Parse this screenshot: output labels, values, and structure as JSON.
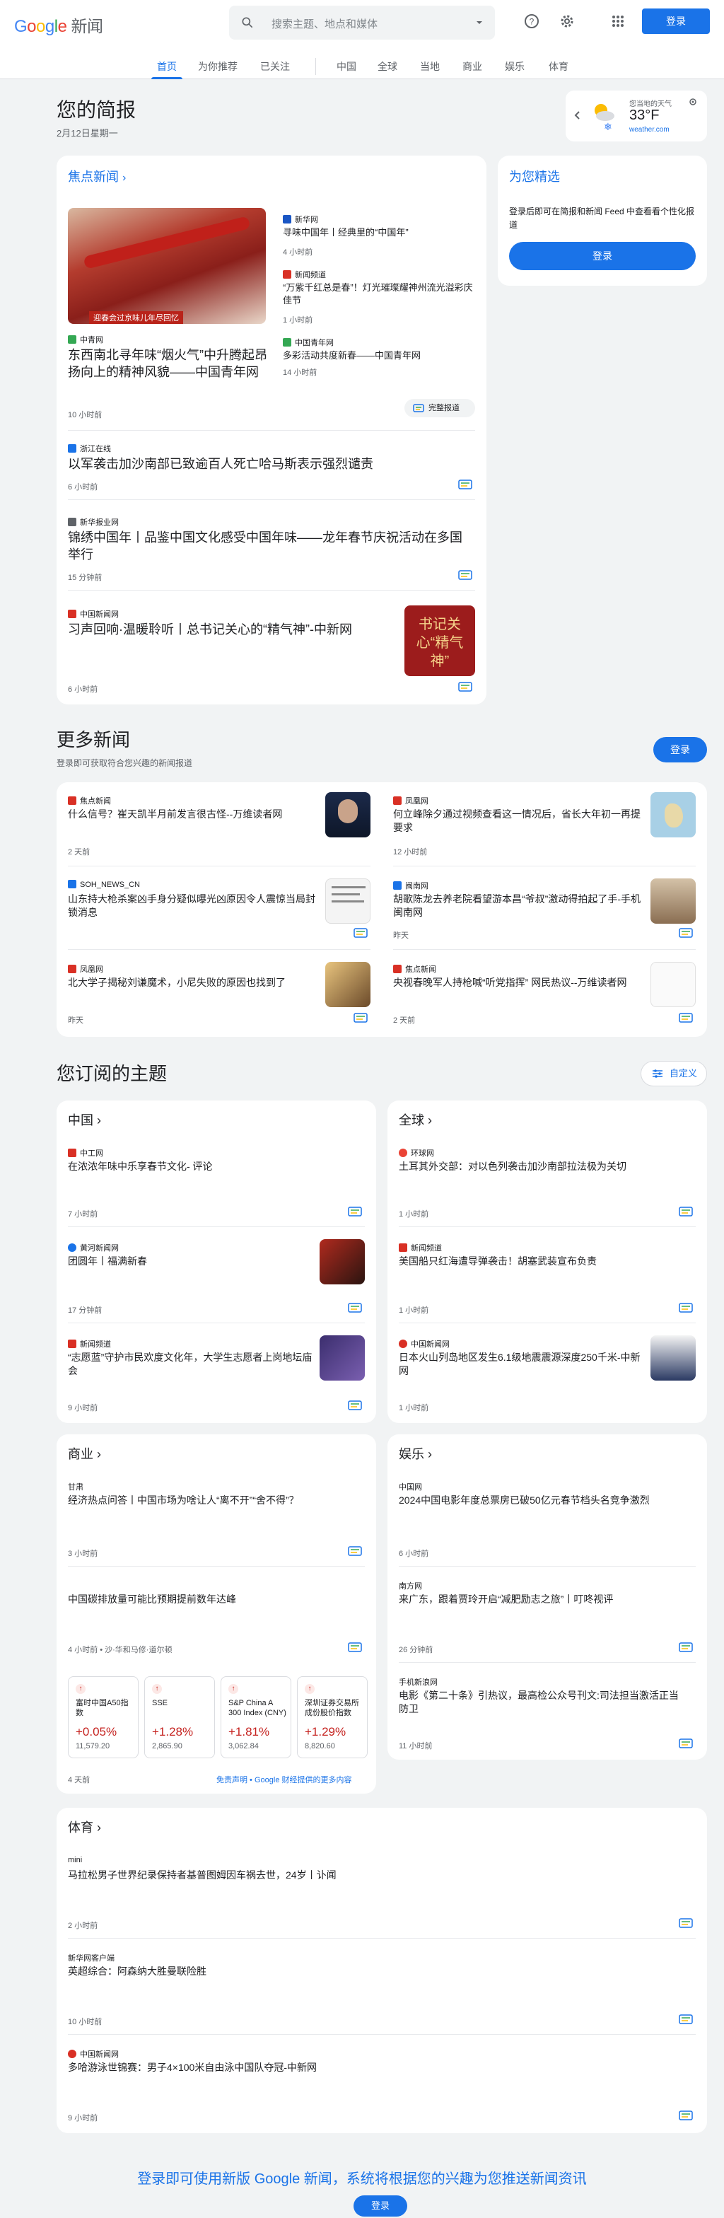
{
  "header": {
    "logo_google": "Google",
    "logo_news": "新闻",
    "search_placeholder": "搜索主题、地点和媒体",
    "signin": "登录"
  },
  "tabs": [
    "首页",
    "为你推荐",
    "已关注",
    "中国",
    "全球",
    "当地",
    "商业",
    "娱乐",
    "体育"
  ],
  "briefing": {
    "title": "您的简报",
    "date": "2月12日星期一"
  },
  "weather": {
    "place": "您当地的天气",
    "temp": "33°F",
    "source": "weather.com"
  },
  "top_stories": {
    "label": "焦点新闻",
    "main": {
      "source": "中青网",
      "title": "东西南北寻年味“烟火气”中升腾起昂扬向上的精神风貌——中国青年网",
      "time": "10 小时前",
      "img_caption": "迎春会过京味儿年尽回忆"
    },
    "side": [
      {
        "source": "新华网",
        "title": "寻味中国年丨经典里的“中国年”",
        "time": "4 小时前"
      },
      {
        "source": "新闻频道",
        "title": "“万紫千红总是春”！灯光璀璨耀神州流光溢彩庆佳节",
        "time": "1 小时前"
      },
      {
        "source": "中国青年网",
        "title": "多彩活动共度新春——中国青年网",
        "time": "14 小时前"
      }
    ],
    "full_coverage": "完整报道",
    "items": [
      {
        "source": "浙江在线",
        "title": "以军袭击加沙南部已致逾百人死亡哈马斯表示强烈谴责",
        "time": "6 小时前"
      },
      {
        "source": "新华报业网",
        "title": "锦绣中国年丨品鉴中国文化感受中国年味——龙年春节庆祝活动在多国举行",
        "time": "15 分钟前"
      },
      {
        "source": "中国新闻网",
        "title": "习声回响·温暖聆听丨总书记关心的“精气神”-中新网",
        "time": "6 小时前",
        "img_text": "书记关心“精气神”"
      }
    ]
  },
  "for_you": {
    "title": "为您精选",
    "desc": "登录后即可在简报和新闻 Feed 中查看看个性化报道",
    "button": "登录"
  },
  "more_news": {
    "title": "更多新闻",
    "sub": "登录即可获取符合您兴趣的新闻报道",
    "button": "登录",
    "items": [
      {
        "source": "焦点新闻",
        "title": "什么信号？崔天凯半月前发言很古怪--万维读者网",
        "time": "2 天前"
      },
      {
        "source": "凤凰网",
        "title": "何立峰除夕通过视频查看这一情况后，省长大年初一再提要求",
        "time": "12 小时前"
      },
      {
        "source": "SOH_NEWS_CN",
        "title": "山东持大枪杀案凶手身分疑似曝光凶原因令人震惊当局封锁消息",
        "time": ""
      },
      {
        "source": "闽南网",
        "title": "胡歌陈龙去养老院看望游本昌“爷叔”激动得拍起了手-手机闽南网",
        "time": "昨天"
      },
      {
        "source": "凤凰网",
        "title": "北大学子揭秘刘谦魔术，小尼失败的原因也找到了",
        "time": "昨天"
      },
      {
        "source": "焦点新闻",
        "title": "央视春晚军人持枪喊“听党指挥” 网民热议--万维读者网",
        "time": "2 天前"
      }
    ]
  },
  "topics": {
    "title": "您订阅的主题",
    "customize": "自定义"
  },
  "china": {
    "title": "中国",
    "items": [
      {
        "source": "中工网",
        "title": "在浓浓年味中乐享春节文化- 评论",
        "time": "7 小时前"
      },
      {
        "source": "黄河新闻网",
        "title": "团圆年丨福满新春",
        "time": "17 分钟前"
      },
      {
        "source": "新闻频道",
        "title": "“志愿蓝”守护市民欢度文化年，大学生志愿者上岗地坛庙会",
        "time": "9 小时前"
      }
    ]
  },
  "world": {
    "title": "全球",
    "items": [
      {
        "source": "环球网",
        "title": "土耳其外交部：对以色列袭击加沙南部拉法极为关切",
        "time": "1 小时前"
      },
      {
        "source": "新闻频道",
        "title": "美国船只红海遭导弹袭击！胡塞武装宣布负责",
        "time": "1 小时前"
      },
      {
        "source": "中国新闻网",
        "title": "日本火山列岛地区发生6.1级地震震源深度250千米-中新网",
        "time": "1 小时前"
      }
    ]
  },
  "business": {
    "title": "商业",
    "items": [
      {
        "source": "甘肃",
        "title": "经济热点问答丨中国市场为啥让人“离不开”“舍不得”？",
        "time": "3 小时前"
      },
      {
        "source": "",
        "title": "中国碳排放量可能比预期提前数年达峰",
        "time": "4 小时前 • 沙·华和马修·道尔顿"
      }
    ],
    "stocks": [
      {
        "name": "富时中国A50指数",
        "change": "+0.05%",
        "price": "11,579.20"
      },
      {
        "name": "SSE",
        "change": "+1.28%",
        "price": "2,865.90"
      },
      {
        "name": "S&P China A 300 Index (CNY)",
        "change": "+1.81%",
        "price": "3,062.84"
      },
      {
        "name": "深圳证券交易所成份股价指数",
        "change": "+1.29%",
        "price": "8,820.60"
      }
    ],
    "footer_time": "4 天前",
    "footer_link": "免责声明 • Google 财经提供的更多内容"
  },
  "entertainment": {
    "title": "娱乐",
    "items": [
      {
        "source": "中国网",
        "title": "2024中国电影年度总票房已破50亿元春节档头名竞争激烈",
        "time": "6 小时前"
      },
      {
        "source": "南方网",
        "title": "来广东，跟着贾玲开启“减肥励志之旅”丨叮咚视评",
        "time": "26 分钟前"
      },
      {
        "source": "手机新浪网",
        "title": "电影《第二十条》引热议，最高检公众号刊文:司法担当激活正当防卫",
        "time": "11 小时前"
      }
    ]
  },
  "sports": {
    "title": "体育",
    "items": [
      {
        "source": "mini",
        "title": "马拉松男子世界纪录保持者基普图姆因车祸去世，24岁丨讣闻",
        "time": "2 小时前"
      },
      {
        "source": "新华网客户端",
        "title": "英超综合：阿森纳大胜曼联险胜",
        "time": "10 小时前"
      },
      {
        "source": "中国新闻网",
        "title": "多哈游泳世锦赛：男子4×100米自由泳中国队夺冠-中新网",
        "time": "9 小时前"
      }
    ]
  },
  "footer": {
    "text": "登录即可使用新版 Google 新闻，系统将根据您的兴趣为您推送新闻资讯",
    "button": "登录"
  }
}
